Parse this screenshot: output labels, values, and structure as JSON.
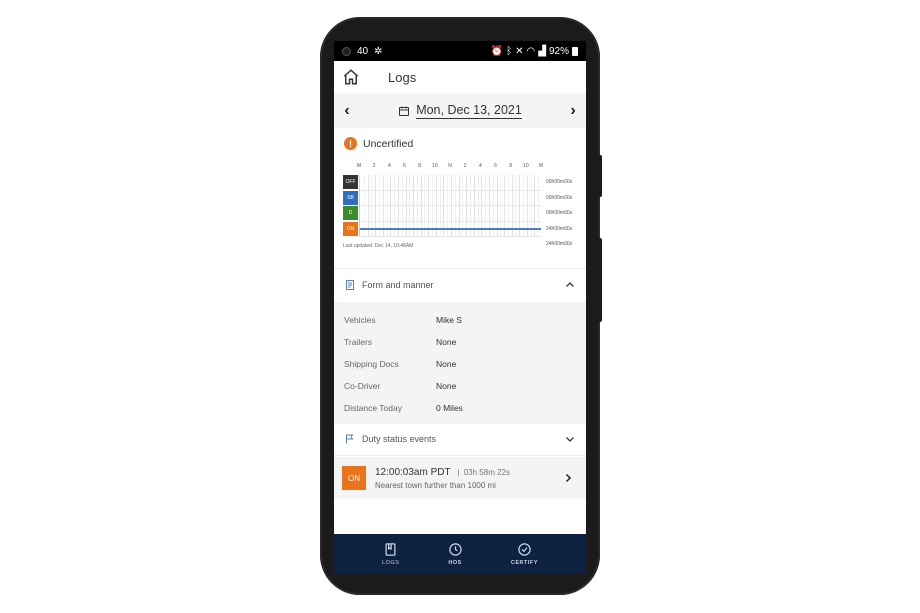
{
  "status_bar": {
    "time": "40",
    "battery": "92%"
  },
  "header": {
    "title": "Logs"
  },
  "date_nav": {
    "date": "Mon, Dec 13, 2021"
  },
  "certification": {
    "status": "Uncertified"
  },
  "graph": {
    "hour_labels": [
      "M",
      "2",
      "4",
      "6",
      "8",
      "10",
      "N",
      "2",
      "4",
      "6",
      "8",
      "10",
      "M"
    ],
    "rows": [
      {
        "label": "OFF",
        "color": "#333333",
        "total": "00h00m00s"
      },
      {
        "label": "SB",
        "color": "#2f6fc0",
        "total": "00h00m00s"
      },
      {
        "label": "D",
        "color": "#3b8a2e",
        "total": "00h00m00s"
      },
      {
        "label": "ON",
        "color": "#e8741b",
        "total": "24h00m00s"
      }
    ],
    "grand_total": "24h00m00s",
    "last_updated": "Last updated: Dec 14, 10:48AM"
  },
  "form_and_manner": {
    "title": "Form and manner",
    "rows": [
      {
        "key": "Vehicles",
        "value": "Mike S"
      },
      {
        "key": "Trailers",
        "value": "None"
      },
      {
        "key": "Shipping Docs",
        "value": "None"
      },
      {
        "key": "Co-Driver",
        "value": "None"
      },
      {
        "key": "Distance Today",
        "value": "0 Miles"
      }
    ]
  },
  "duty_status_events": {
    "title": "Duty status events",
    "events": [
      {
        "badge": "ON",
        "time": "12:00:03am PDT",
        "duration": "03h 58m 22s",
        "location": "Nearest town further than 1000 mi"
      }
    ]
  },
  "bottom_nav": {
    "logs": "LOGS",
    "hos": "HOS",
    "certify": "CERTIFY"
  },
  "colors": {
    "accent": "#e8741b",
    "nav_bg": "#0d2140"
  }
}
